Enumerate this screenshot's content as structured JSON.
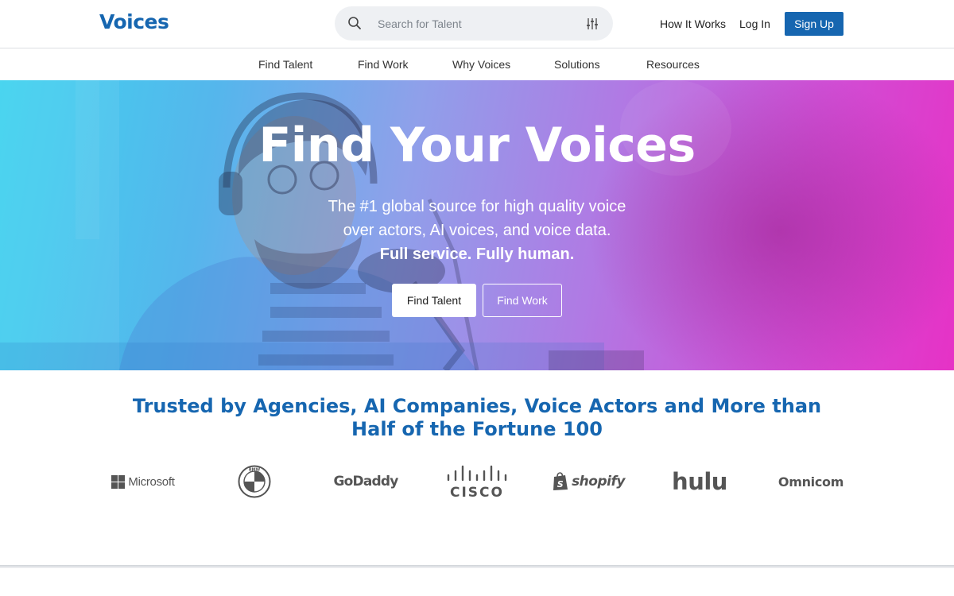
{
  "header": {
    "logo_text": "Voices",
    "search_placeholder": "Search for Talent",
    "how_it_works": "How It Works",
    "log_in": "Log In",
    "sign_up": "Sign Up"
  },
  "subnav": {
    "items": [
      "Find Talent",
      "Find Work",
      "Why Voices",
      "Solutions",
      "Resources"
    ]
  },
  "hero": {
    "title": "Find Your Voices",
    "subtitle_line1": "The #1 global source for high quality voice",
    "subtitle_line2": "over actors, AI voices, and voice data.",
    "subtitle_line3": "Full service. Fully human.",
    "find_talent_button": "Find Talent",
    "find_work_button": "Find Work"
  },
  "trusted": {
    "heading": "Trusted by Agencies, AI Companies, Voice Actors and More than Half of the Fortune 100"
  },
  "logos": {
    "microsoft": "Microsoft",
    "bmw": "BMW",
    "godaddy": "GoDaddy",
    "cisco": "CISCO",
    "shopify": "shopify",
    "hulu": "hulu",
    "omnicom": "Omnicom"
  },
  "colors": {
    "brand_blue": "#1666b0",
    "hero_gradient_start": "#3fd3ef",
    "hero_gradient_end": "#e632c6",
    "logo_gray": "#555555"
  },
  "icons": {
    "search": "search-icon",
    "filter": "filter-sliders-icon"
  }
}
